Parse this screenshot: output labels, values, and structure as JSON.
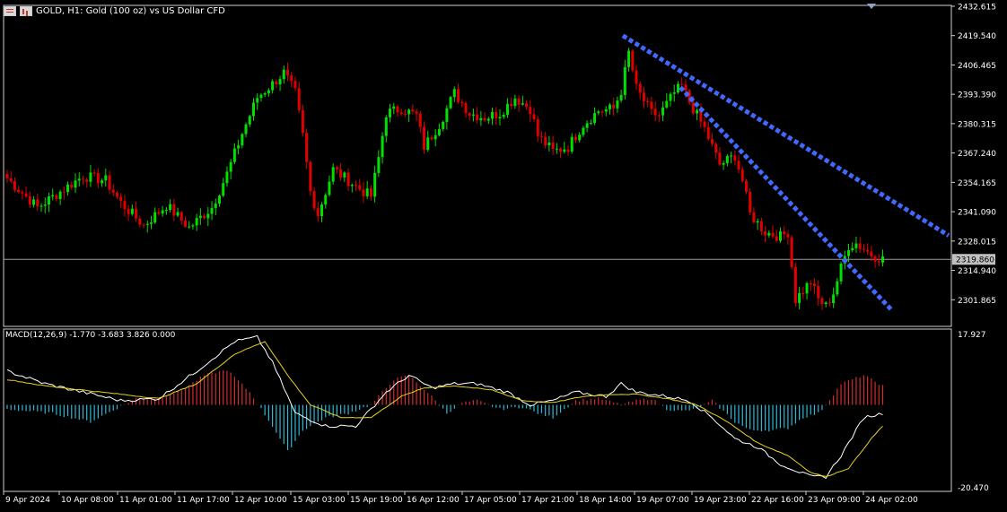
{
  "header": {
    "symbol_text": "GOLD, H1:  Gold (100 oz) vs US Dollar CFD",
    "grid_icon": "grid-icon",
    "chart_icon": "chart-type-icon"
  },
  "macd_label": "MACD(12,26,9) -1.770 -3.683 3.826 0.000",
  "colors": {
    "background": "#000000",
    "bull": "#00e000",
    "bear": "#e00000",
    "trendline": "#4169ff",
    "macd_pos": "#d22e2e",
    "macd_neg": "#2fb8d6",
    "macd_line": "#ffffff",
    "signal_line": "#e6d21e",
    "axis_text": "#ffffff",
    "current_price_bg": "#c0c0c0"
  },
  "chart_data": [
    {
      "type": "candlestick",
      "title": "GOLD, H1:  Gold (100 oz) vs US Dollar CFD",
      "ylim": [
        2290.0,
        2433.0
      ],
      "y_ticks": [
        "2432.615",
        "2419.540",
        "2406.465",
        "2393.390",
        "2380.315",
        "2367.240",
        "2354.165",
        "2341.090",
        "2328.015",
        "2314.940",
        "2301.865"
      ],
      "current_price": "2319.860",
      "x_ticks": [
        "9 Apr 2024",
        "10 Apr 08:00",
        "11 Apr 01:00",
        "11 Apr 17:00",
        "12 Apr 10:00",
        "15 Apr 03:00",
        "15 Apr 19:00",
        "16 Apr 12:00",
        "17 Apr 05:00",
        "17 Apr 21:00",
        "18 Apr 14:00",
        "19 Apr 07:00",
        "19 Apr 23:00",
        "22 Apr 16:00",
        "23 Apr 09:00",
        "24 Apr 02:00"
      ],
      "anchors": [
        [
          0,
          2356
        ],
        [
          8,
          2343
        ],
        [
          14,
          2350
        ],
        [
          20,
          2357
        ],
        [
          26,
          2355
        ],
        [
          30,
          2345
        ],
        [
          36,
          2335
        ],
        [
          42,
          2344
        ],
        [
          48,
          2334
        ],
        [
          54,
          2343
        ],
        [
          58,
          2358
        ],
        [
          62,
          2376
        ],
        [
          66,
          2392
        ],
        [
          70,
          2398
        ],
        [
          73,
          2403
        ],
        [
          76,
          2394
        ],
        [
          78,
          2375
        ],
        [
          80,
          2350
        ],
        [
          82,
          2340
        ],
        [
          86,
          2360
        ],
        [
          90,
          2355
        ],
        [
          94,
          2350
        ],
        [
          96,
          2348
        ],
        [
          98,
          2365
        ],
        [
          100,
          2385
        ],
        [
          104,
          2387
        ],
        [
          108,
          2384
        ],
        [
          110,
          2370
        ],
        [
          114,
          2380
        ],
        [
          118,
          2394
        ],
        [
          122,
          2385
        ],
        [
          126,
          2383
        ],
        [
          130,
          2385
        ],
        [
          134,
          2392
        ],
        [
          138,
          2387
        ],
        [
          140,
          2375
        ],
        [
          144,
          2368
        ],
        [
          148,
          2370
        ],
        [
          152,
          2380
        ],
        [
          156,
          2386
        ],
        [
          160,
          2387
        ],
        [
          162,
          2395
        ],
        [
          164,
          2412
        ],
        [
          166,
          2396
        ],
        [
          170,
          2385
        ],
        [
          172,
          2384
        ],
        [
          176,
          2394
        ],
        [
          178,
          2397
        ],
        [
          180,
          2390
        ],
        [
          184,
          2378
        ],
        [
          188,
          2362
        ],
        [
          192,
          2366
        ],
        [
          194,
          2355
        ],
        [
          196,
          2340
        ],
        [
          200,
          2332
        ],
        [
          204,
          2330
        ],
        [
          206,
          2332
        ],
        [
          208,
          2302
        ],
        [
          210,
          2306
        ],
        [
          212,
          2310
        ],
        [
          214,
          2302
        ],
        [
          216,
          2299
        ],
        [
          218,
          2305
        ],
        [
          220,
          2316
        ],
        [
          222,
          2326
        ],
        [
          224,
          2327
        ],
        [
          228,
          2322
        ],
        [
          231,
          2320
        ]
      ],
      "trendlines": [
        {
          "from": [
            "18 Apr 14:00",
            2419.5
          ],
          "to": [
            "24 Apr 02:00",
            2330.5
          ]
        },
        {
          "from": [
            "19 Apr 07:00",
            2396.5
          ],
          "to": [
            "23 Apr 09:00",
            2297.5
          ]
        }
      ]
    },
    {
      "type": "macd",
      "params": "MACD(12,26,9)",
      "values": {
        "histogram": -1.77,
        "signal": -3.683,
        "third": 3.826,
        "fourth": 0.0
      },
      "ylim": [
        -20.47,
        17.927
      ],
      "y_ticks": [
        "17.927",
        "-20.470"
      ],
      "hist_anchors": [
        [
          0,
          -1
        ],
        [
          12,
          -2
        ],
        [
          22,
          -4
        ],
        [
          34,
          1.5
        ],
        [
          40,
          1.6
        ],
        [
          46,
          3.5
        ],
        [
          52,
          7
        ],
        [
          58,
          8.3
        ],
        [
          64,
          3
        ],
        [
          70,
          -5
        ],
        [
          74,
          -11
        ],
        [
          78,
          -6
        ],
        [
          84,
          -3
        ],
        [
          90,
          -2
        ],
        [
          96,
          0
        ],
        [
          102,
          6
        ],
        [
          106,
          7
        ],
        [
          112,
          2
        ],
        [
          116,
          -2
        ],
        [
          120,
          0.5
        ],
        [
          124,
          1
        ],
        [
          130,
          -1
        ],
        [
          136,
          -0.5
        ],
        [
          140,
          -2
        ],
        [
          144,
          -3
        ],
        [
          150,
          1
        ],
        [
          156,
          1.5
        ],
        [
          162,
          0
        ],
        [
          166,
          1
        ],
        [
          170,
          1.5
        ],
        [
          174,
          -1
        ],
        [
          178,
          -1.5
        ],
        [
          182,
          -1
        ],
        [
          186,
          1
        ],
        [
          192,
          -4
        ],
        [
          196,
          -6
        ],
        [
          202,
          -6
        ],
        [
          206,
          -5.5
        ],
        [
          210,
          -3
        ],
        [
          214,
          -2
        ],
        [
          216,
          0
        ],
        [
          220,
          5
        ],
        [
          226,
          7
        ],
        [
          231,
          4.5
        ]
      ],
      "line_anchors": [
        [
          0,
          8
        ],
        [
          10,
          5
        ],
        [
          20,
          3
        ],
        [
          30,
          1
        ],
        [
          40,
          1.5
        ],
        [
          50,
          8
        ],
        [
          60,
          15
        ],
        [
          66,
          16
        ],
        [
          70,
          10
        ],
        [
          76,
          -2
        ],
        [
          84,
          -5
        ],
        [
          92,
          -5
        ],
        [
          100,
          3
        ],
        [
          106,
          7
        ],
        [
          112,
          4
        ],
        [
          118,
          5
        ],
        [
          124,
          5
        ],
        [
          132,
          3
        ],
        [
          138,
          0
        ],
        [
          144,
          1
        ],
        [
          150,
          3
        ],
        [
          158,
          2
        ],
        [
          162,
          5
        ],
        [
          166,
          3
        ],
        [
          174,
          2
        ],
        [
          180,
          1
        ],
        [
          186,
          -3
        ],
        [
          192,
          -8
        ],
        [
          198,
          -10
        ],
        [
          204,
          -14
        ],
        [
          208,
          -15.5
        ],
        [
          212,
          -17
        ],
        [
          216,
          -17
        ],
        [
          220,
          -12
        ],
        [
          226,
          -3
        ],
        [
          231,
          -2
        ]
      ],
      "signal_anchors": [
        [
          0,
          6
        ],
        [
          10,
          4.5
        ],
        [
          20,
          3.5
        ],
        [
          30,
          2.5
        ],
        [
          40,
          1.5
        ],
        [
          50,
          5
        ],
        [
          60,
          12
        ],
        [
          68,
          15
        ],
        [
          74,
          7
        ],
        [
          80,
          0
        ],
        [
          88,
          -3
        ],
        [
          96,
          -3
        ],
        [
          104,
          2
        ],
        [
          110,
          4
        ],
        [
          118,
          4.5
        ],
        [
          128,
          3.5
        ],
        [
          136,
          1
        ],
        [
          144,
          0.5
        ],
        [
          152,
          2
        ],
        [
          160,
          2.5
        ],
        [
          166,
          2.5
        ],
        [
          174,
          1.5
        ],
        [
          182,
          0
        ],
        [
          190,
          -4
        ],
        [
          198,
          -9
        ],
        [
          206,
          -12
        ],
        [
          212,
          -16
        ],
        [
          216,
          -17
        ],
        [
          222,
          -15
        ],
        [
          228,
          -8
        ],
        [
          231,
          -5
        ]
      ]
    }
  ]
}
